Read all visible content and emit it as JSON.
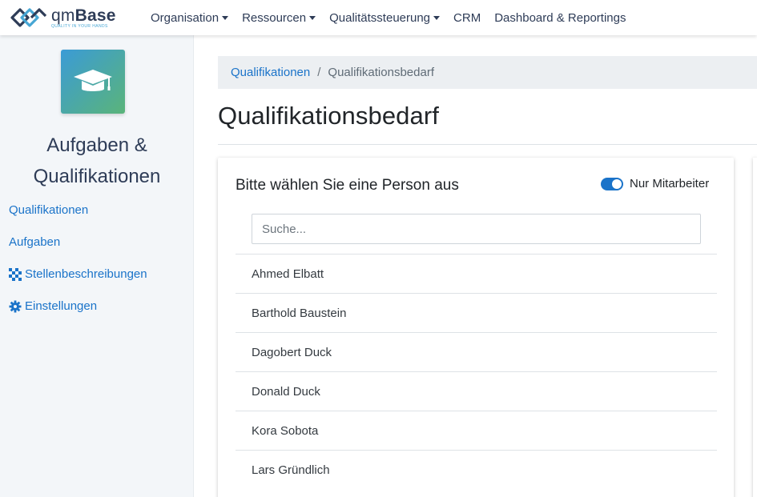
{
  "brand": {
    "name_prefix": "qm",
    "name_suffix": "Base",
    "tagline": "QUALITY IN YOUR HANDS",
    "color": "#2e3c57",
    "accent": "#46a6d4"
  },
  "nav": {
    "items": [
      {
        "label": "Organisation",
        "dropdown": true
      },
      {
        "label": "Ressourcen",
        "dropdown": true
      },
      {
        "label": "Qualitätssteuerung",
        "dropdown": true
      },
      {
        "label": "CRM",
        "dropdown": false
      },
      {
        "label": "Dashboard & Reportings",
        "dropdown": false
      }
    ]
  },
  "sidebar": {
    "module_icon": "graduation-cap-icon",
    "title_line1": "Aufgaben &",
    "title_line2": "Qualifikationen",
    "links": [
      {
        "label": "Qualifikationen",
        "icon": ""
      },
      {
        "label": "Aufgaben",
        "icon": ""
      },
      {
        "label": "Stellenbeschreibungen",
        "icon": "checker-icon"
      },
      {
        "label": "Einstellungen",
        "icon": "gear-icon"
      }
    ]
  },
  "breadcrumb": {
    "parent": "Qualifikationen",
    "separator": "/",
    "current": "Qualifikationsbedarf"
  },
  "page": {
    "title": "Qualifikationsbedarf"
  },
  "card": {
    "title": "Bitte wählen Sie eine Person aus",
    "toggle_label": "Nur Mitarbeiter",
    "toggle_on": true,
    "search_placeholder": "Suche...",
    "search_value": "",
    "persons": [
      "Ahmed Elbatt",
      "Barthold Baustein",
      "Dagobert Duck",
      "Donald Duck",
      "Kora Sobota",
      "Lars Gründlich"
    ]
  },
  "colors": {
    "link": "#1a73c9",
    "sidebar_bg": "#f3f6f9",
    "breadcrumb_bg": "#eceff2",
    "gradient_start": "#3b9bd6",
    "gradient_end": "#5ab47a"
  }
}
